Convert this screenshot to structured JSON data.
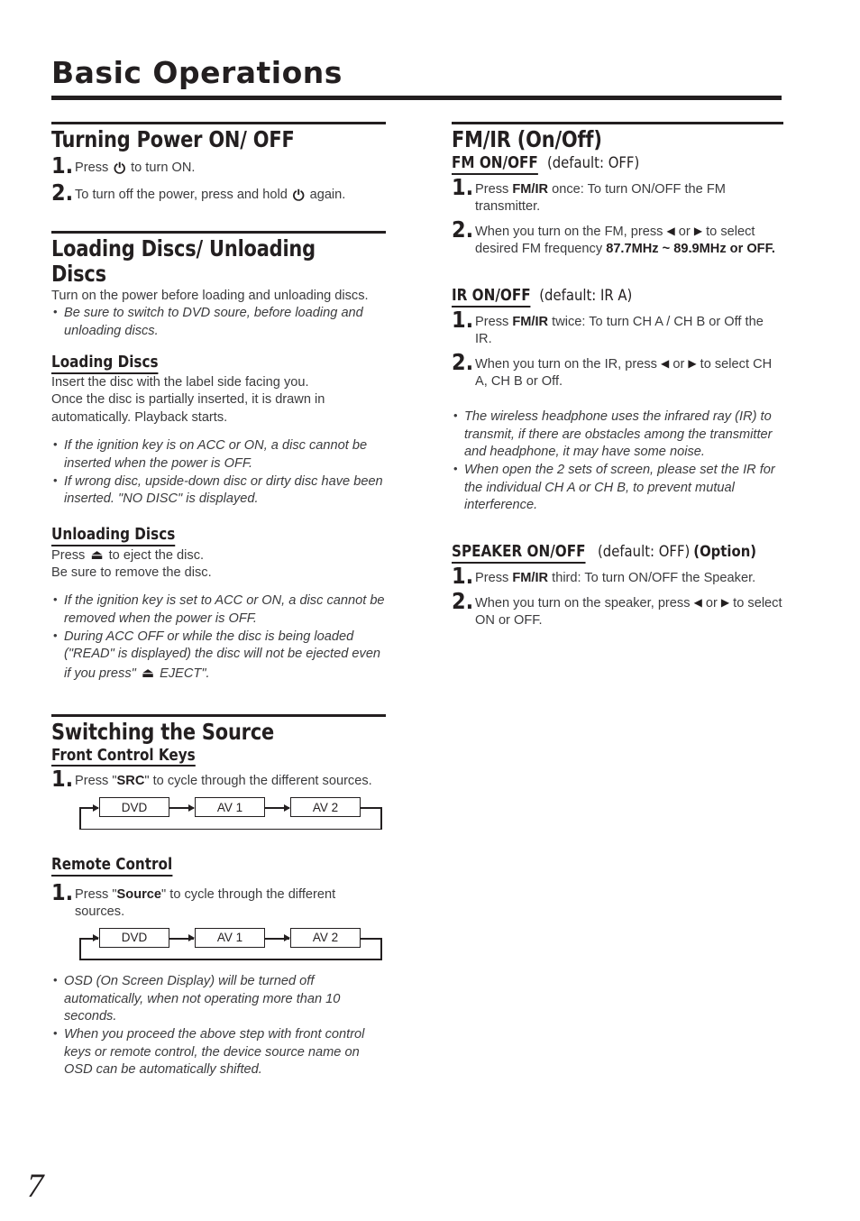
{
  "document": {
    "title": "Basic Operations",
    "page_number": "7"
  },
  "icons": {
    "power": "⏻",
    "eject": "⏏",
    "left_triangle": "◀",
    "right_triangle": "▶"
  },
  "left_column": {
    "power_section": {
      "heading": "Turning Power ON/ OFF",
      "steps": [
        {
          "num": "1.",
          "pre": "Press ",
          "icon": "power",
          "post": " to turn ON."
        },
        {
          "num": "2.",
          "pre": "To turn off the power, press and hold ",
          "icon": "power",
          "post": " again."
        }
      ]
    },
    "discs_section": {
      "heading": "Loading Discs/ Unloading Discs",
      "intro": "Turn on the power before loading and unloading discs.",
      "intro_notes": [
        "Be sure to switch to DVD soure, before loading and unloading discs."
      ],
      "loading": {
        "heading": "Loading Discs",
        "body_lines": [
          "Insert the disc with the label side facing you.",
          "Once the disc is partially inserted, it is drawn in",
          "automatically. Playback starts."
        ],
        "notes": [
          "If the ignition key is on ACC or ON, a disc cannot be inserted when the power is OFF.",
          "If wrong disc, upside-down disc or dirty disc have been inserted. \"NO DISC\" is displayed."
        ]
      },
      "unloading": {
        "heading": "Unloading Discs",
        "press_pre": "Press ",
        "press_post": " to eject the disc.",
        "body_line2": "Be sure to remove the disc.",
        "notes": [
          "If the ignition key is set to ACC or ON, a disc cannot be removed when the power is OFF."
        ],
        "note2_a": "During ACC OFF or while the disc is being loaded (\"READ\" is displayed) the disc will not be ejected even if you press\" ",
        "note2_b": " EJECT\"."
      }
    },
    "source_section": {
      "heading": "Switching the Source",
      "front_keys": {
        "heading": "Front Control Keys",
        "step_num": "1.",
        "step_pre": "Press \"",
        "step_key": "SRC",
        "step_post": "\" to cycle through the different sources.",
        "flow": [
          "DVD",
          "AV 1",
          "AV 2"
        ]
      },
      "remote": {
        "heading": "Remote Control",
        "step_num": "1.",
        "step_pre": "Press \"",
        "step_key": "Source",
        "step_post": "\" to cycle through the different sources.",
        "flow": [
          "DVD",
          "AV 1",
          "AV 2"
        ],
        "notes": [
          "OSD (On Screen Display) will be turned off automatically, when not operating more than 10 seconds.",
          "When you proceed the above step with front control keys or remote control, the device source name on OSD can be automatically shifted."
        ]
      }
    }
  },
  "right_column": {
    "fmir_section": {
      "heading": "FM/IR (On/Off)",
      "fm": {
        "heading": "FM ON/OFF",
        "default_note": "(default: OFF)",
        "step1_num": "1.",
        "step1_pre": "Press ",
        "step1_key": "FM/IR",
        "step1_post": " once: To turn ON/OFF the FM transmitter.",
        "step2_num": "2.",
        "step2_a": "When you turn on the FM, press ",
        "step2_b": " or ",
        "step2_c": " to select desired FM frequency ",
        "step2_bold": "87.7MHz ~ 89.9MHz or OFF."
      },
      "ir": {
        "heading": "IR ON/OFF",
        "default_note": "(default: IR A)",
        "step1_num": "1.",
        "step1_pre": "Press ",
        "step1_key": "FM/IR",
        "step1_post": " twice: To turn CH A / CH B or Off the IR.",
        "step2_num": "2.",
        "step2_a": "When you turn on the IR, press ",
        "step2_b": " or ",
        "step2_c": " to select CH A, CH B or Off.",
        "notes": [
          "The wireless headphone uses the infrared ray (IR) to transmit, if there are obstacles among the transmitter and headphone, it may have some noise.",
          "When open the 2 sets of screen, please set the IR for the individual CH A or CH B, to prevent mutual interference."
        ]
      },
      "speaker": {
        "heading": "SPEAKER ON/OFF",
        "default_note": "(default: OFF)",
        "option_note": "(Option)",
        "step1_num": "1.",
        "step1_pre": "Press ",
        "step1_key": "FM/IR",
        "step1_post": " third: To turn ON/OFF the Speaker.",
        "step2_num": "2.",
        "step2_a": "When you turn on the speaker, press ",
        "step2_b": " or ",
        "step2_c": " to select ON or OFF."
      }
    }
  }
}
